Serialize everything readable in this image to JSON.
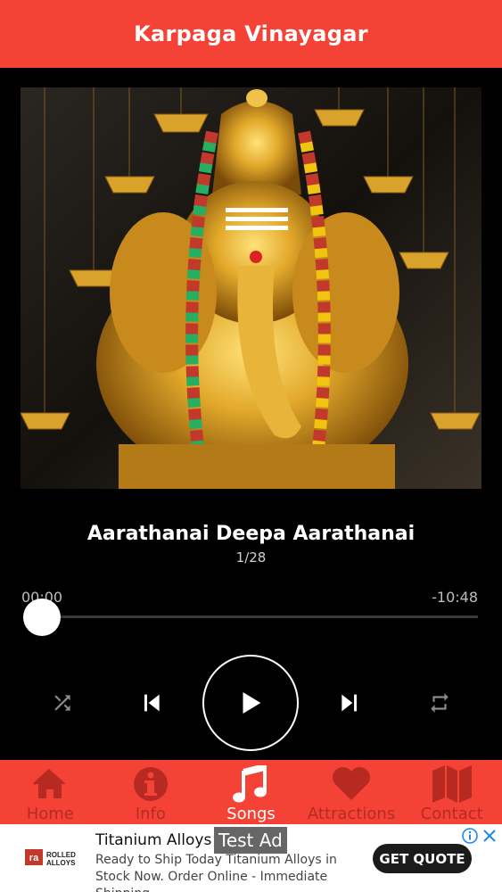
{
  "header": {
    "title": "Karpaga Vinayagar"
  },
  "player": {
    "song_title": "Aarathanai Deepa Aarathanai",
    "track_position": "1/28",
    "elapsed": "00:00",
    "remaining": "-10:48",
    "progress": 0.0
  },
  "tabs": [
    {
      "label": "Home",
      "icon": "home-icon",
      "active": false
    },
    {
      "label": "Info",
      "icon": "info-icon",
      "active": false
    },
    {
      "label": "Songs",
      "icon": "music-note-icon",
      "active": true
    },
    {
      "label": "Attractions",
      "icon": "heart-icon",
      "active": false
    },
    {
      "label": "Contact",
      "icon": "map-icon",
      "active": false
    }
  ],
  "ad": {
    "logo_text": "ROLLED ALLOYS",
    "title": "Titanium Alloys",
    "badge": "Test Ad",
    "description": "Ready to Ship Today Titanium Alloys in Stock Now. Order Online - Immediate Shipping.",
    "cta": "GET QUOTE"
  },
  "colors": {
    "primary": "#f44336",
    "tab_inactive": "#b62a22",
    "background": "#000000"
  }
}
